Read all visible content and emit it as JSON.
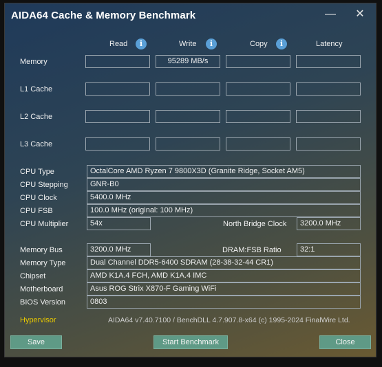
{
  "window": {
    "title": "AIDA64 Cache & Memory Benchmark",
    "minimize_glyph": "—",
    "close_glyph": "✕"
  },
  "columns": {
    "read": "Read",
    "write": "Write",
    "copy": "Copy",
    "latency": "Latency",
    "info_glyph": "i"
  },
  "benchmark_rows": [
    {
      "label": "Memory",
      "read": "",
      "write": "95289 MB/s",
      "copy": "",
      "latency": ""
    },
    {
      "label": "L1 Cache",
      "read": "",
      "write": "",
      "copy": "",
      "latency": ""
    },
    {
      "label": "L2 Cache",
      "read": "",
      "write": "",
      "copy": "",
      "latency": ""
    },
    {
      "label": "L3 Cache",
      "read": "",
      "write": "",
      "copy": "",
      "latency": ""
    }
  ],
  "cpu": {
    "type_label": "CPU Type",
    "type_value": "OctalCore AMD Ryzen 7 9800X3D  (Granite Ridge, Socket AM5)",
    "stepping_label": "CPU Stepping",
    "stepping_value": "GNR-B0",
    "clock_label": "CPU Clock",
    "clock_value": "5400.0 MHz",
    "fsb_label": "CPU FSB",
    "fsb_value": "100.0 MHz  (original: 100 MHz)",
    "multiplier_label": "CPU Multiplier",
    "multiplier_value": "54x",
    "nb_clock_label": "North Bridge Clock",
    "nb_clock_value": "3200.0 MHz"
  },
  "memory": {
    "bus_label": "Memory Bus",
    "bus_value": "3200.0 MHz",
    "ratio_label": "DRAM:FSB Ratio",
    "ratio_value": "32:1",
    "type_label": "Memory Type",
    "type_value": "Dual Channel DDR5-6400 SDRAM  (28-38-32-44 CR1)",
    "chipset_label": "Chipset",
    "chipset_value": "AMD K1A.4 FCH, AMD K1A.4 IMC",
    "motherboard_label": "Motherboard",
    "motherboard_value": "Asus ROG Strix X870-F Gaming WiFi",
    "bios_label": "BIOS Version",
    "bios_value": "0803"
  },
  "footer": {
    "hypervisor": "Hypervisor",
    "version_text": "AIDA64 v7.40.7100 / BenchDLL 4.7.907.8-x64  (c) 1995-2024 FinalWire Ltd."
  },
  "buttons": {
    "save": "Save",
    "start": "Start Benchmark",
    "close": "Close"
  },
  "colors": {
    "hypervisor": "#e8c800",
    "button": "#5f9a86",
    "info_icon": "#5a9fd6"
  }
}
